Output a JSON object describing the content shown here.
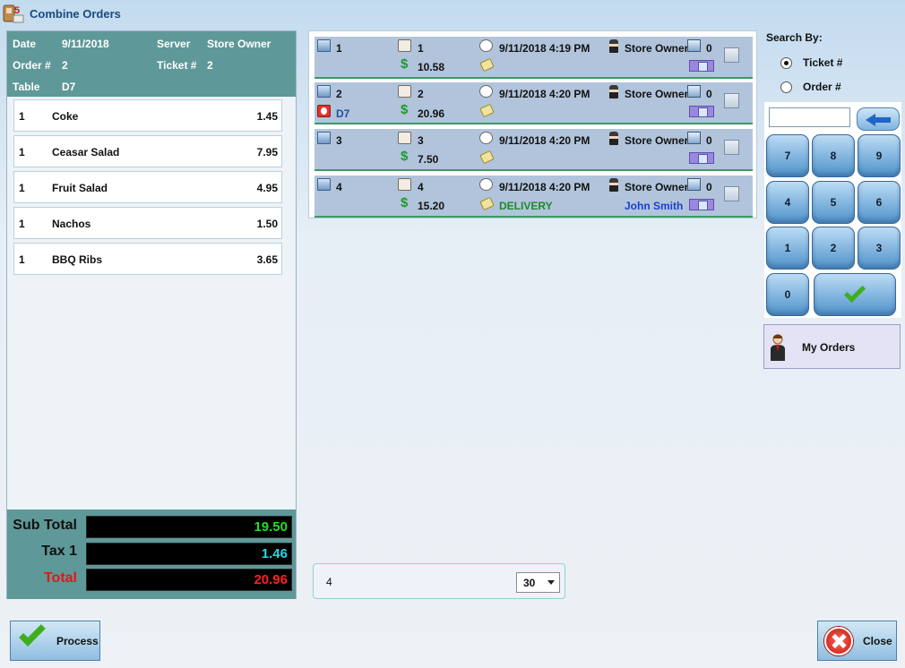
{
  "window": {
    "title": "Combine Orders"
  },
  "order": {
    "date_label": "Date",
    "date": "9/11/2018",
    "server_label": "Server",
    "server": "Store Owner",
    "order_label": "Order #",
    "order_no": "2",
    "ticket_label": "Ticket #",
    "ticket_no": "2",
    "table_label": "Table",
    "table": "D7"
  },
  "items": [
    {
      "qty": "1",
      "name": "Coke",
      "price": "1.45"
    },
    {
      "qty": "1",
      "name": "Ceasar Salad",
      "price": "7.95"
    },
    {
      "qty": "1",
      "name": "Fruit Salad",
      "price": "4.95"
    },
    {
      "qty": "1",
      "name": "Nachos",
      "price": "1.50"
    },
    {
      "qty": "1",
      "name": "BBQ Ribs",
      "price": "3.65"
    }
  ],
  "totals": {
    "sub_total_label": "Sub Total",
    "sub_total": "19.50",
    "tax_label": "Tax 1",
    "tax": "1.46",
    "total_label": "Total",
    "total": "20.96",
    "colors": {
      "sub_total": "#20e020",
      "tax": "#2ad6e6",
      "total": "#ff2020",
      "total_label": "#e01818"
    }
  },
  "orders": [
    {
      "order_no": "1",
      "ticket": "1",
      "datetime": "9/11/2018 4:19 PM",
      "server": "Store Owner",
      "station": "0",
      "amount": "10.58",
      "table": "",
      "order_type": "",
      "customer": ""
    },
    {
      "order_no": "2",
      "ticket": "2",
      "datetime": "9/11/2018 4:20 PM",
      "server": "Store Owner",
      "station": "0",
      "amount": "20.96",
      "table": "D7",
      "order_type": "",
      "customer": ""
    },
    {
      "order_no": "3",
      "ticket": "3",
      "datetime": "9/11/2018 4:20 PM",
      "server": "Store Owner",
      "station": "0",
      "amount": "7.50",
      "table": "",
      "order_type": "",
      "customer": ""
    },
    {
      "order_no": "4",
      "ticket": "4",
      "datetime": "9/11/2018 4:20 PM",
      "server": "Store Owner",
      "station": "0",
      "amount": "15.20",
      "table": "",
      "order_type": "DELIVERY",
      "customer": "John Smith"
    }
  ],
  "bottom_input": {
    "value": "4",
    "select_value": "30"
  },
  "search": {
    "label": "Search By:",
    "options": [
      {
        "label": "Ticket #",
        "selected": true
      },
      {
        "label": "Order #",
        "selected": false
      }
    ],
    "input_value": "",
    "keys": [
      "7",
      "8",
      "9",
      "4",
      "5",
      "6",
      "1",
      "2",
      "3",
      "0"
    ]
  },
  "buttons": {
    "my_orders": "My Orders",
    "process": "Process",
    "close": "Close"
  },
  "icons": {
    "app": "app-icon",
    "monitor": "monitor-icon",
    "hand": "hand-icon",
    "clock": "clock-icon",
    "person": "person-icon",
    "pc": "pc-icon",
    "dollar": "dollar-icon",
    "note": "note-icon",
    "table": "table-icon",
    "back": "backspace-icon",
    "enter": "check-icon",
    "close": "close-icon"
  }
}
